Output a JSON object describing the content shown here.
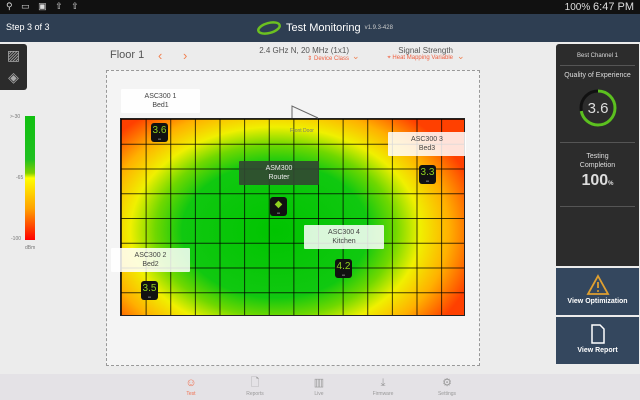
{
  "status_bar": {
    "left_icons": "⚲ ▭ ▣ ⇧ ⇧",
    "battery": "100%",
    "time": "6:47 PM"
  },
  "app_bar": {
    "step": "Step 3 of 3",
    "title": "Test Monitoring",
    "version": "v1.9.3-428",
    "logo_color": "#6cc020"
  },
  "floor": {
    "label": "Floor 1",
    "prev": "‹",
    "next": "›"
  },
  "band_select": {
    "value": "2.4 GHz N, 20 MHz (1x1)",
    "sub": "Device Class"
  },
  "heat_select": {
    "value": "Signal Strength",
    "sub": "Heat Mapping Variable"
  },
  "legend": {
    "top": ">-30",
    "mid": "-65",
    "bottom": "-100",
    "unit": "dBm"
  },
  "map": {
    "front_door": "Front Door",
    "nodes": [
      {
        "name": "ASC300 1",
        "room": "Bed1",
        "score": "3.6"
      },
      {
        "name": "ASC300 2",
        "room": "Bed2",
        "score": "3.5"
      },
      {
        "name": "ASC300 3",
        "room": "Bed3",
        "score": "3.3"
      },
      {
        "name": "ASC300 4",
        "room": "Kitchen",
        "score": "4.2"
      }
    ],
    "router": {
      "name": "ASM300",
      "room": "Router"
    }
  },
  "side_panel": {
    "best_channel": "Best Channel 1",
    "qoe_label": "Quality of Experience",
    "qoe_value": "3.6",
    "qoe_max": 5,
    "testing_label1": "Testing",
    "testing_label2": "Completion",
    "testing_value": "100",
    "testing_unit": "%"
  },
  "actions": {
    "optimization": "View Optimization",
    "report": "View Report"
  },
  "nav": [
    {
      "label": "Test",
      "icon": "test-icon",
      "active": true
    },
    {
      "label": "Reports",
      "icon": "document-icon"
    },
    {
      "label": "Live",
      "icon": "bar-chart-icon"
    },
    {
      "label": "Firmware",
      "icon": "download-icon"
    },
    {
      "label": "Settings",
      "icon": "gear-icon"
    }
  ]
}
